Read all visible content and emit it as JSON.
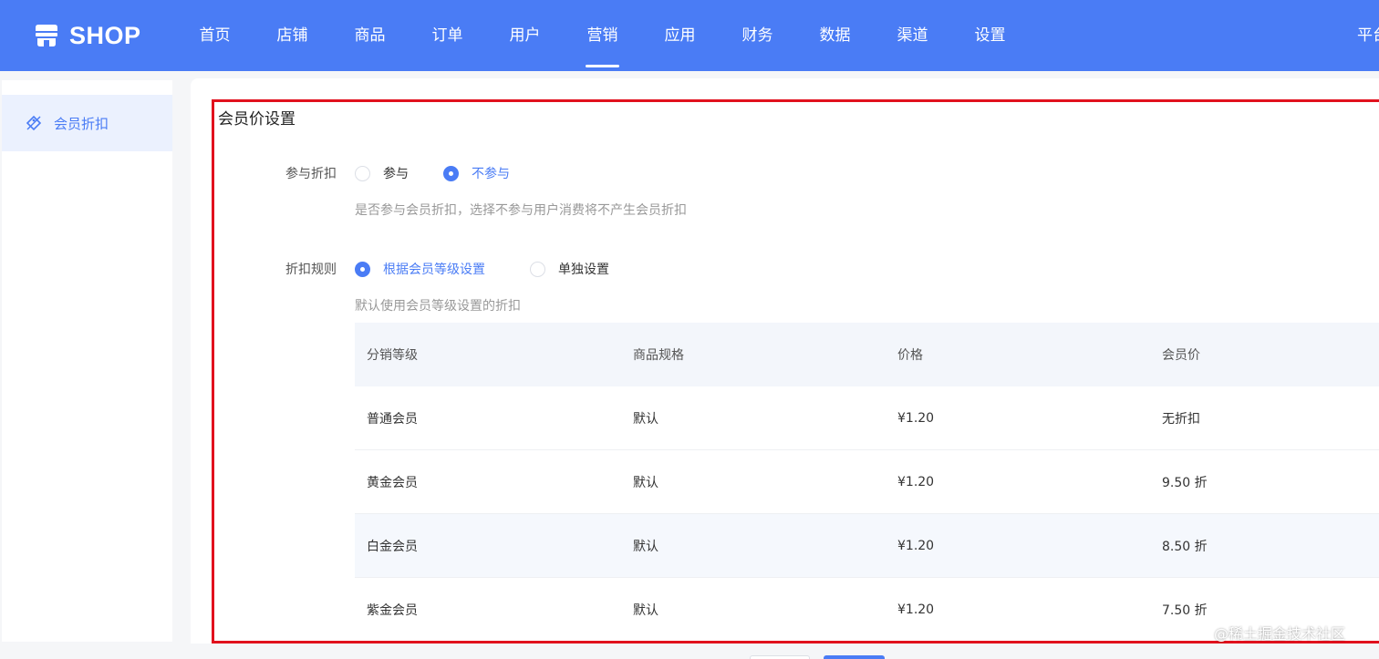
{
  "brand": {
    "name": "SHOP",
    "icon": "shop-store-icon"
  },
  "nav": {
    "items": [
      {
        "label": "首页"
      },
      {
        "label": "店铺"
      },
      {
        "label": "商品"
      },
      {
        "label": "订单"
      },
      {
        "label": "用户"
      },
      {
        "label": "营销",
        "active": true
      },
      {
        "label": "应用"
      },
      {
        "label": "财务"
      },
      {
        "label": "数据"
      },
      {
        "label": "渠道"
      },
      {
        "label": "设置"
      }
    ],
    "right_label": "平台"
  },
  "sidebar": {
    "items": [
      {
        "label": "会员折扣",
        "icon": "discount-tag-icon",
        "active": true
      }
    ]
  },
  "main": {
    "title": "会员价设置",
    "participate": {
      "label": "参与折扣",
      "options": [
        {
          "label": "参与",
          "checked": false
        },
        {
          "label": "不参与",
          "checked": true
        }
      ],
      "hint": "是否参与会员折扣，选择不参与用户消费将不产生会员折扣"
    },
    "rule": {
      "label": "折扣规则",
      "options": [
        {
          "label": "根据会员等级设置",
          "checked": true
        },
        {
          "label": "单独设置",
          "checked": false
        }
      ],
      "hint": "默认使用会员等级设置的折扣"
    },
    "table": {
      "headers": [
        "分销等级",
        "商品规格",
        "价格",
        "会员价"
      ],
      "rows": [
        [
          "普通会员",
          "默认",
          "¥1.20",
          "无折扣"
        ],
        [
          "黄金会员",
          "默认",
          "¥1.20",
          "9.50 折"
        ],
        [
          "白金会员",
          "默认",
          "¥1.20",
          "8.50 折"
        ],
        [
          "紫金会员",
          "默认",
          "¥1.20",
          "7.50 折"
        ]
      ]
    }
  },
  "watermark": "@稀土掘金技术社区",
  "colors": {
    "primary": "#4a7cf5",
    "highlight": "#e1111d"
  }
}
